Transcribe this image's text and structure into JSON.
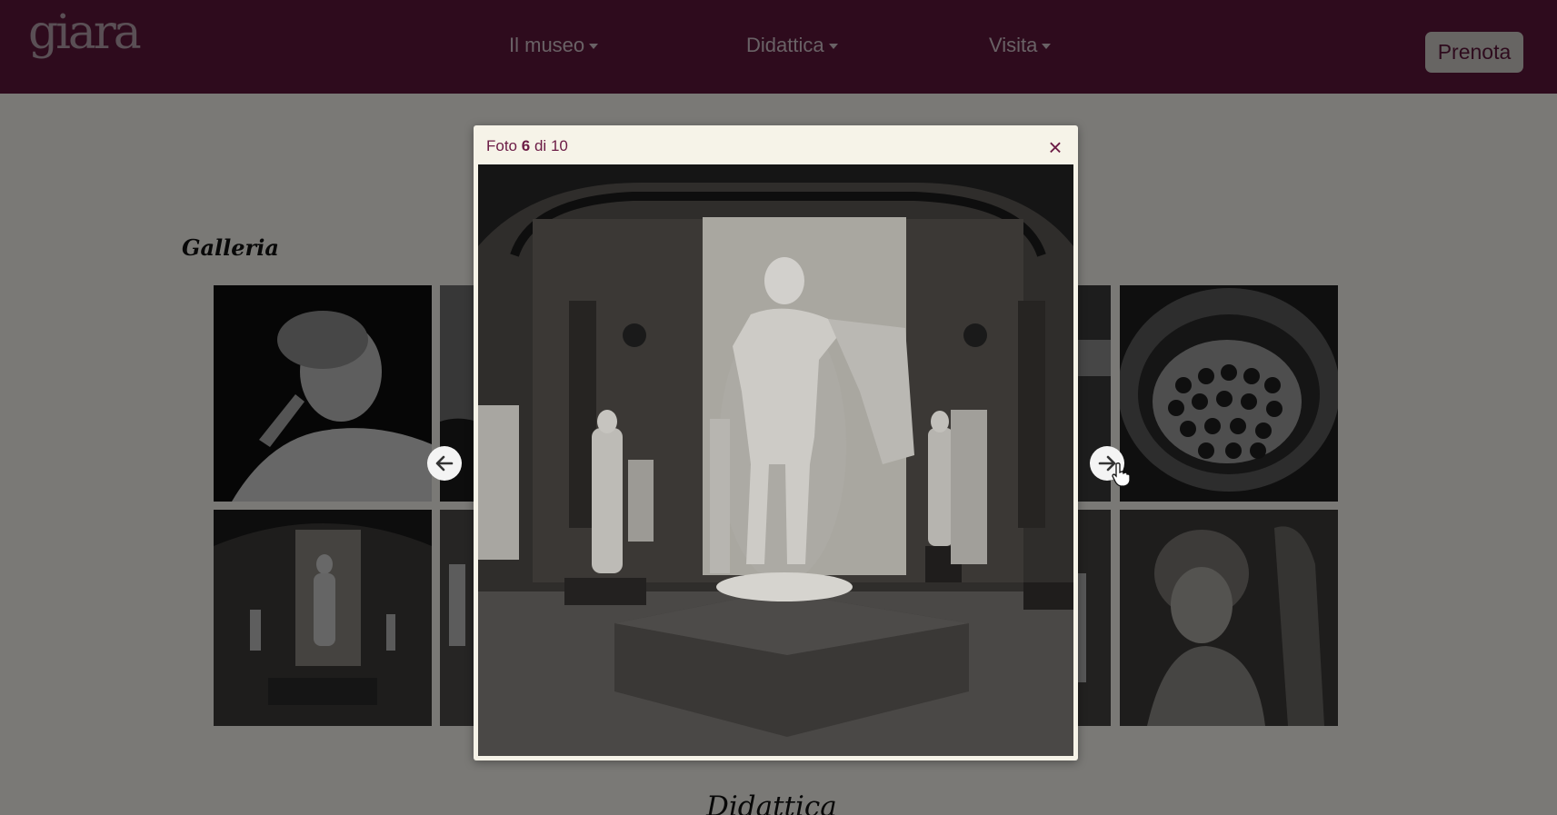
{
  "header": {
    "logo": "giara",
    "nav": [
      {
        "label": "Il museo"
      },
      {
        "label": "Didattica"
      },
      {
        "label": "Visita"
      }
    ],
    "cta_label": "Prenota"
  },
  "gallery": {
    "title": "Galleria"
  },
  "next_section": {
    "title": "Didattica"
  },
  "lightbox": {
    "caption_prefix": "Foto",
    "current": "6",
    "of_word": "di",
    "total": "10",
    "close_glyph": "×"
  },
  "colors": {
    "brand": "#6b1b45",
    "button_bg": "#ece7e3",
    "modal_bg": "#f6f3e8"
  }
}
